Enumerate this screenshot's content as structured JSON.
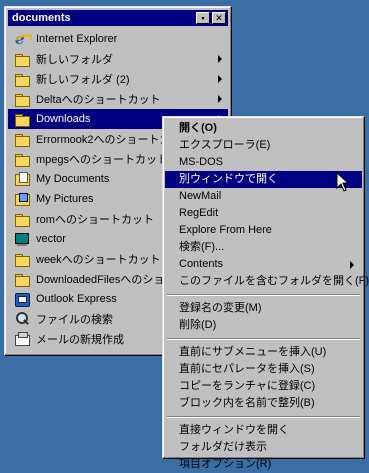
{
  "window": {
    "title": "documents",
    "minimize_glyph": "▪",
    "close_glyph": "✕"
  },
  "items": [
    {
      "label": "Internet Explorer",
      "icon": "internet-explorer-icon",
      "submenu": false
    },
    {
      "label": "新しいフォルダ",
      "icon": "folder-icon",
      "submenu": true
    },
    {
      "label": "新しいフォルダ (2)",
      "icon": "folder-icon",
      "submenu": true
    },
    {
      "label": "Deltaへのショートカット",
      "icon": "folder-icon",
      "submenu": true
    },
    {
      "label": "Downloads",
      "icon": "folder-icon",
      "submenu": true,
      "selected": true
    },
    {
      "label": "Errormook2へのショートカット",
      "icon": "folder-icon",
      "submenu": true
    },
    {
      "label": "mpegsへのショートカット",
      "icon": "folder-icon",
      "submenu": true
    },
    {
      "label": "My Documents",
      "icon": "my-documents-icon",
      "submenu": true
    },
    {
      "label": "My Pictures",
      "icon": "my-pictures-icon",
      "submenu": true
    },
    {
      "label": "romへのショートカット",
      "icon": "folder-icon",
      "submenu": true
    },
    {
      "label": "vector",
      "icon": "monitor-icon",
      "submenu": true
    },
    {
      "label": "weekへのショートカット",
      "icon": "folder-icon",
      "submenu": true
    },
    {
      "label": "DownloadedFilesへのショートカット",
      "icon": "folder-icon",
      "submenu": true
    },
    {
      "label": "Outlook Express",
      "icon": "outlook-icon",
      "submenu": false
    },
    {
      "label": "ファイルの検索",
      "icon": "search-icon",
      "submenu": false
    },
    {
      "label": "メールの新規作成",
      "icon": "new-mail-icon",
      "submenu": false
    }
  ],
  "context_menu": {
    "groups": [
      [
        {
          "label": "開く(O)",
          "bold": true
        },
        {
          "label": "エクスプローラ(E)"
        },
        {
          "label": "MS-DOS"
        },
        {
          "label": "別ウィンドウで開く",
          "highlighted": true
        },
        {
          "label": "NewMail"
        },
        {
          "label": "RegEdit"
        },
        {
          "label": "Explore From Here"
        },
        {
          "label": "検索(F)..."
        },
        {
          "label": "Contents",
          "submenu": true
        },
        {
          "label": "このファイルを含むフォルダを開く(F)"
        }
      ],
      [
        {
          "label": "登録名の変更(M)"
        },
        {
          "label": "削除(D)"
        }
      ],
      [
        {
          "label": "直前にサブメニューを挿入(U)"
        },
        {
          "label": "直前にセパレータを挿入(S)"
        },
        {
          "label": "コピーをランチャに登録(C)"
        },
        {
          "label": "ブロック内を名前で整列(B)"
        }
      ],
      [
        {
          "label": "直接ウィンドウを開く"
        },
        {
          "label": "フォルダだけ表示"
        },
        {
          "label": "項目オプション(R)"
        }
      ]
    ]
  },
  "colors": {
    "desktop": "#3a6ea5",
    "titlebar": "#000080",
    "highlight": "#000080",
    "face": "#c0c0c0"
  }
}
